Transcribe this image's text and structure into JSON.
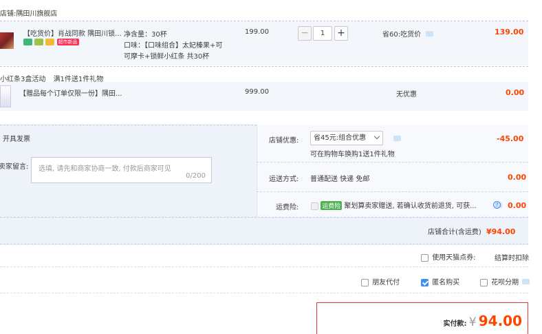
{
  "shop": {
    "label_prefix": "店铺:",
    "name": "隅田川旗舰店"
  },
  "item1": {
    "title": "【吃货价】肖战同款 隅田川锁...",
    "spec_line1": "净含量：30杯",
    "spec_line2": "口味：【口味组合】太妃榛果+可",
    "spec_line3": "可摩卡+锁鲜小红条 共30杯",
    "price": "199.00",
    "qty": "1",
    "minus": "−",
    "plus": "+",
    "discount": "省60:吃货价",
    "total": "139.00",
    "badge_text": "超市新品"
  },
  "promo": {
    "name": "小红条3盒活动",
    "rule": "满1件送1件礼物"
  },
  "gift": {
    "title": "【赠品每个订单仅限一份】隅田...",
    "price": "999.00",
    "discount": "无优惠",
    "total": "0.00"
  },
  "invoice": {
    "label": "开具发票"
  },
  "message": {
    "label": "给卖家留言:",
    "placeholder": "选填, 请先和商家协商一致, 付款后商家可见",
    "counter": "0/200"
  },
  "shop_discount": {
    "label": "店铺优惠:",
    "selected": "省45元:组合优惠",
    "note": "可在购物车换购1送1件礼物",
    "amount": "-45.00"
  },
  "shipping": {
    "label": "运送方式:",
    "method": "普通配送 快递 免邮",
    "amount": "0.00"
  },
  "insurance": {
    "label": "运费险:",
    "badge": "运费险",
    "desc": "聚划算卖家赠送, 若确认收货前退货, 可获...",
    "amount": "0.00"
  },
  "shop_total": {
    "label": "店铺合计(含运费)",
    "value": "¥94.00"
  },
  "tmall_points": {
    "label": "使用天猫点券:",
    "note": "结算时扣除"
  },
  "options": {
    "friend_pay": "朋友代付",
    "anonymous": "匿名购买",
    "huabei": "花呗分期"
  },
  "payment": {
    "label": "实付款:",
    "currency": "¥",
    "amount": "94.00"
  },
  "colors": {
    "accent": "#ff4400",
    "panel": "#eef3fa",
    "border": "#b6c8e6",
    "pay_border": "#e4393c"
  }
}
